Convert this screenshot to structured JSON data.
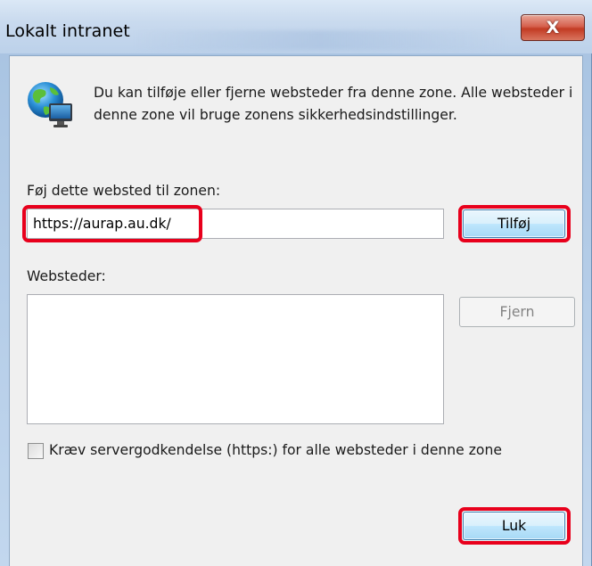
{
  "window": {
    "title": "Lokalt intranet",
    "close_glyph": "X"
  },
  "info": {
    "icon": "globe-computer-icon",
    "text": "Du kan tilføje eller fjerne websteder fra denne zone. Alle websteder i denne zone vil bruge zonens sikkerhedsindstillinger."
  },
  "add_site": {
    "label": "Føj dette websted til zonen:",
    "value": "https://aurap.au.dk/",
    "button_label": "Tilføj"
  },
  "sites": {
    "label": "Websteder:",
    "items": [],
    "remove_label": "Fjern"
  },
  "require_https": {
    "label": "Kræv servergodkendelse (https:) for alle websteder i denne zone",
    "checked": false
  },
  "footer": {
    "close_label": "Luk"
  },
  "colors": {
    "highlight": "#e8001c",
    "close_button": "#c94a34",
    "dialog_bg": "#f0f0f0"
  }
}
